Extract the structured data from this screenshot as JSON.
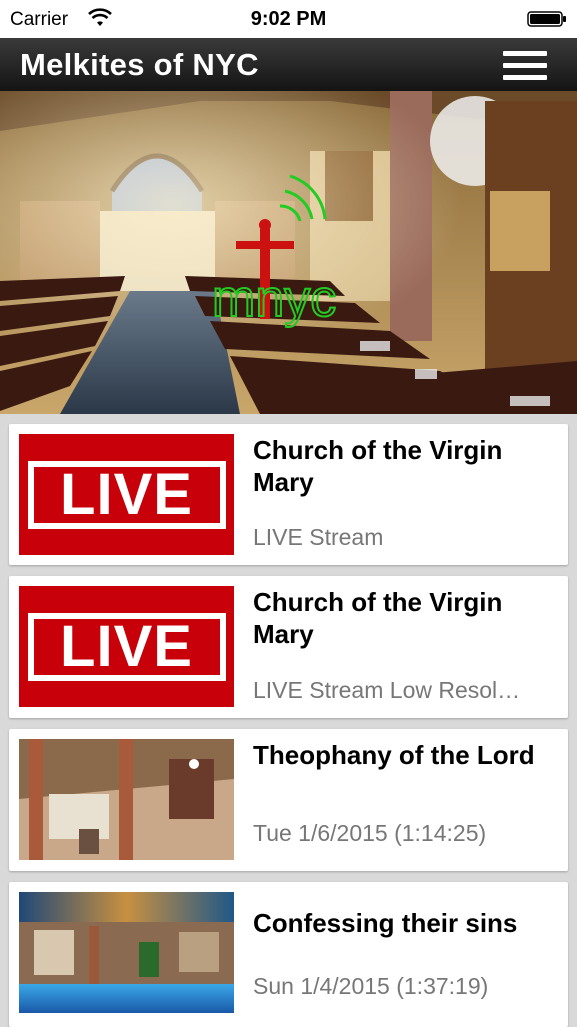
{
  "status_bar": {
    "carrier": "Carrier",
    "time": "9:02 PM"
  },
  "nav": {
    "title": "Melkites of NYC",
    "menu_icon": "hamburger-menu-icon"
  },
  "hero": {
    "logo_text": "mnyc",
    "logo_color": "#22cc22",
    "cross_color": "#cc1111"
  },
  "items": [
    {
      "title": "Church of the Virgin Mary",
      "subtitle": "LIVE Stream",
      "thumb_label": "LIVE"
    },
    {
      "title": "Church of the Virgin Mary",
      "subtitle": "LIVE Stream Low Resol…",
      "thumb_label": "LIVE"
    },
    {
      "title": "Theophany of the Lord",
      "subtitle": "Tue 1/6/2015 (1:14:25)"
    },
    {
      "title": "Confessing their sins",
      "subtitle": "Sun 1/4/2015 (1:37:19)"
    }
  ],
  "colors": {
    "live_red": "#c8000a",
    "nav_dark": "#1e1e1e",
    "list_bg": "#d9d9d9"
  }
}
